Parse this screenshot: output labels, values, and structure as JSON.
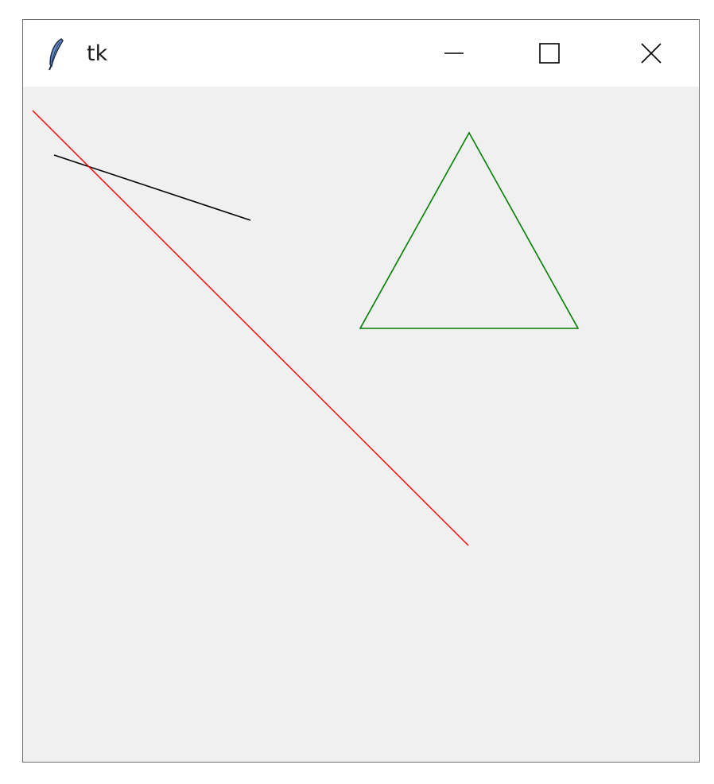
{
  "window": {
    "title": "tk",
    "app_icon": "tk-feather-icon",
    "controls": {
      "minimize": "minimize-icon",
      "maximize": "maximize-icon",
      "close": "close-icon"
    }
  },
  "canvas": {
    "background": "#f0f0f0",
    "shapes": [
      {
        "type": "line",
        "color": "#000000"
      },
      {
        "type": "line",
        "color": "#ff0000"
      },
      {
        "type": "polygon",
        "outline": "#008000"
      }
    ]
  }
}
